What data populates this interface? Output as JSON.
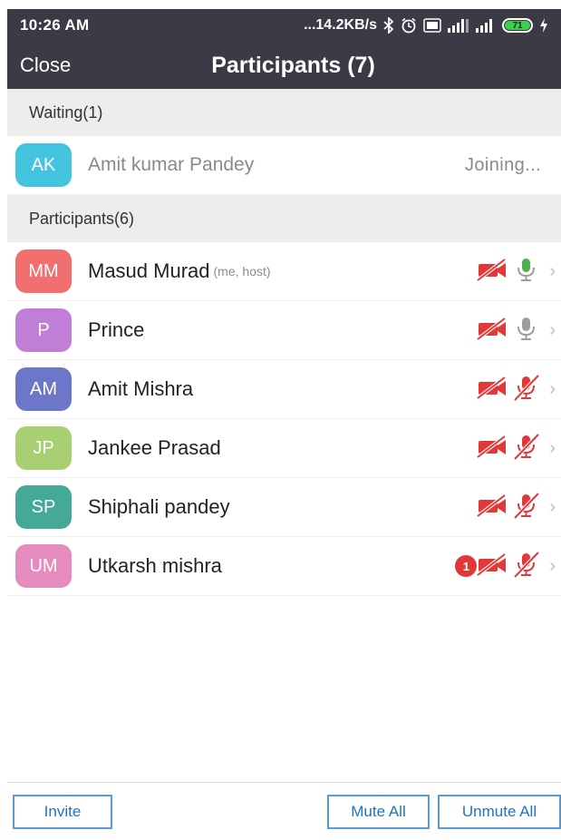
{
  "status_bar": {
    "time": "10:26 AM",
    "network_speed": "...14.2KB/s",
    "battery_level": "71",
    "icons": [
      "bluetooth-icon",
      "alarm-icon",
      "volte-icon",
      "signal-4g-icon",
      "signal-icon",
      "battery-icon",
      "charging-icon"
    ]
  },
  "header": {
    "close_label": "Close",
    "title": "Participants (7)"
  },
  "waiting": {
    "header": "Waiting(1)",
    "items": [
      {
        "initials": "AK",
        "name": "Amit kumar Pandey",
        "status": "Joining...",
        "color": "#45c4e0"
      }
    ]
  },
  "participants": {
    "header": "Participants(6)",
    "items": [
      {
        "initials": "MM",
        "name": "Masud Murad",
        "tag": "(me, host)",
        "color": "#f26f6f",
        "mic": "on",
        "video": "off",
        "unread": ""
      },
      {
        "initials": "P",
        "name": "Prince",
        "tag": "",
        "color": "#c07ed6",
        "mic": "idle",
        "video": "off",
        "unread": ""
      },
      {
        "initials": "AM",
        "name": "Amit Mishra",
        "tag": "",
        "color": "#6c77c9",
        "mic": "muted",
        "video": "off",
        "unread": ""
      },
      {
        "initials": "JP",
        "name": "Jankee Prasad",
        "tag": "",
        "color": "#a9cf73",
        "mic": "muted",
        "video": "off",
        "unread": ""
      },
      {
        "initials": "SP",
        "name": "Shiphali pandey",
        "tag": "",
        "color": "#44a996",
        "mic": "muted",
        "video": "off",
        "unread": ""
      },
      {
        "initials": "UM",
        "name": "Utkarsh mishra",
        "tag": "",
        "color": "#e58bbd",
        "mic": "muted",
        "video": "off",
        "unread": "1"
      }
    ]
  },
  "footer": {
    "invite_label": "Invite",
    "mute_all_label": "Mute All",
    "unmute_all_label": "Unmute All"
  },
  "colors": {
    "header_bg": "#3a3b45",
    "button_blue": "#1f73c4",
    "muted_red": "#e23838",
    "mic_on_green": "#4caf50"
  }
}
